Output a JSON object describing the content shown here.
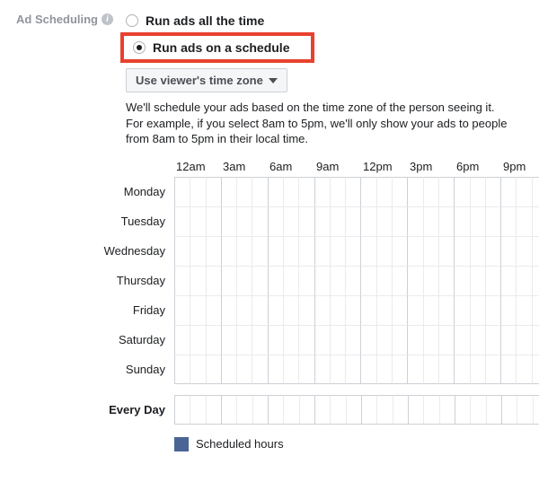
{
  "section": {
    "label": "Ad Scheduling"
  },
  "radios": {
    "all_time": "Run ads all the time",
    "schedule": "Run ads on a schedule"
  },
  "timezone": {
    "selected": "Use viewer's time zone"
  },
  "description": {
    "line1": "We'll schedule your ads based on the time zone of the person seeing it.",
    "line2": "For example, if you select 8am to 5pm, we'll only show your ads to people from 8am to 5pm in their local time."
  },
  "times": [
    "12am",
    "3am",
    "6am",
    "9am",
    "12pm",
    "3pm",
    "6pm",
    "9pm"
  ],
  "days": [
    "Monday",
    "Tuesday",
    "Wednesday",
    "Thursday",
    "Friday",
    "Saturday",
    "Sunday"
  ],
  "every_day": "Every Day",
  "legend": {
    "scheduled": "Scheduled hours"
  }
}
